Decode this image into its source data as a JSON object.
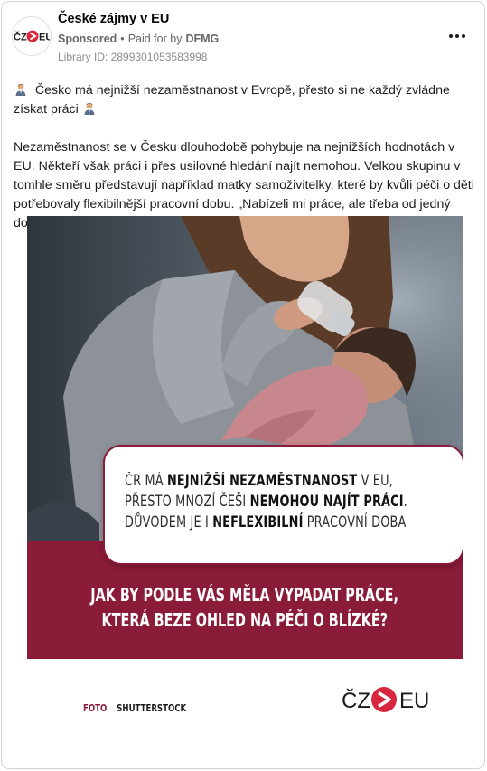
{
  "page": {
    "name": "České zájmy v EU",
    "sponsored": "Sponsored",
    "separator": "•",
    "paid_for_by_label": "Paid for by",
    "paid_for_by": "DFMG",
    "library_id": "Library ID: 2899301053583998"
  },
  "avatar_logo": {
    "left": "ČZ",
    "right": "EU",
    "icon": "cz-eu-arrow-logo"
  },
  "menu": {
    "icon": "more-horizontal-icon"
  },
  "post": {
    "headline_emoji": "man-office-worker-emoji",
    "headline": "Česko má nejnižší nezaměstnanost v Evropě, přesto si ne každý zvládne získat práci",
    "paragraph": "Nezaměstnanost se v Česku dlouhodobě pohybuje na nejnižších hodnotách v EU. Někteří však práci i přes usilovné hledání najít nemohou. Velkou skupinu v tomhle směru představují například matky samoživitelky, které by kvůli péči o děti potřebovaly flexibilnější pracovní dobu. „Nabízeli mi práce, ale třeba od jedný do…"
  },
  "creative": {
    "photo_alt": "mother-feeding-baby-with-bottle-photo",
    "quote": {
      "l1_a": "ČR má ",
      "l1_b": "nejnižší nezaměstnanost",
      "l1_c": " v EU,",
      "l2_a": "přesto mnozí Češi ",
      "l2_b": "nemohou najít práci",
      "l2_c": ".",
      "l3_a": "Důvodem je i ",
      "l3_b": "neflexibilní",
      "l3_c": " pracovní doba"
    },
    "question_line1": "Jak by podle vás měla vypadat práce,",
    "question_line2": "která beze ohled na péči o blízké?",
    "credit_label": "FOTO",
    "credit_source": "SHUTTERSTOCK",
    "logo_left": "ČZ",
    "logo_right": "EU"
  },
  "colors": {
    "brand": "#8a1b39",
    "arrow": "#d7263d",
    "text": "#1c1e21",
    "meta": "#65676b"
  }
}
